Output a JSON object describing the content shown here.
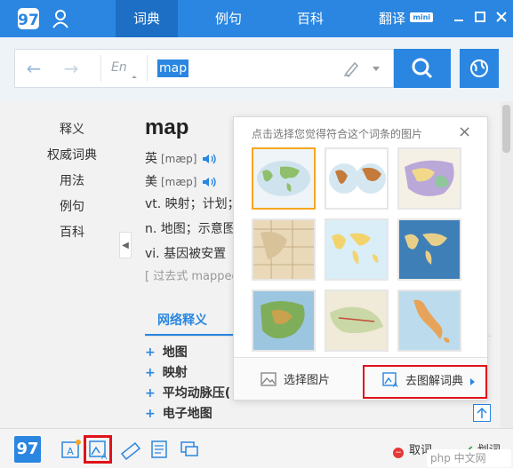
{
  "colors": {
    "brand": "#2a86e0",
    "highlight_border": "#e0121a",
    "selected_thumb": "#f5a623"
  },
  "topbar": {
    "tabs": [
      "词典",
      "例句",
      "百科",
      "翻译"
    ],
    "active_tab": "词典",
    "mini_label": "mini"
  },
  "search": {
    "lang_label": "En",
    "query": "map"
  },
  "leftnav": [
    "释义",
    "权威词典",
    "用法",
    "例句",
    "百科"
  ],
  "entry": {
    "word": "map",
    "uk_label": "英",
    "uk_phonetic": "[mæp]",
    "us_label": "美",
    "us_phonetic": "[mæp]",
    "defs": [
      "vt. 映射；计划；",
      "n. 地图；示意图",
      "vi. 基因被安置"
    ],
    "tense": "[ 过去式 mapped"
  },
  "web": {
    "heading": "网络释义",
    "items": [
      "地图",
      "映射",
      "平均动脉压(",
      "电子地图"
    ]
  },
  "popup": {
    "title": "点击选择您觉得符合这个词条的图片",
    "pick_label": "选择图片",
    "go_label": "去图解词典"
  },
  "bottom": {
    "cancel_label": "取词",
    "select_label": "划词",
    "watermark": "php 中文网"
  }
}
